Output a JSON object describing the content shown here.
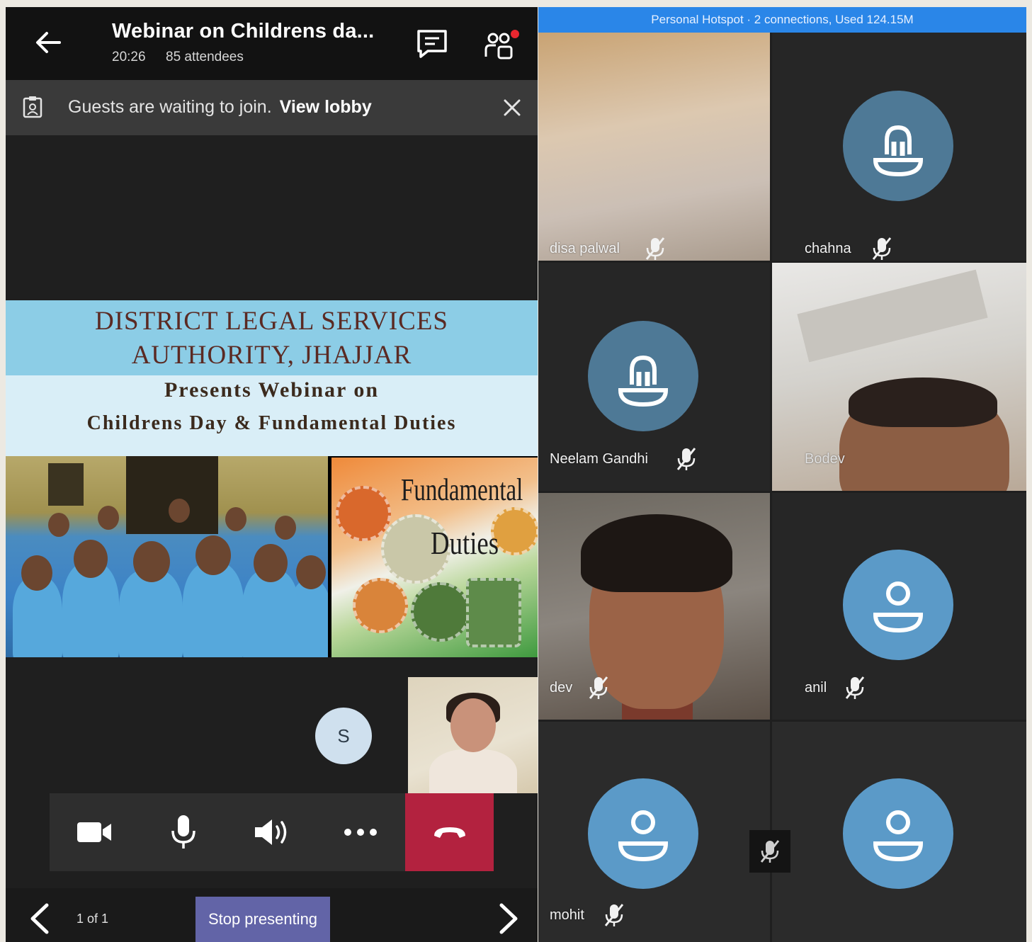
{
  "meeting": {
    "title": "Webinar on Childrens da...",
    "time": "20:26",
    "attendees": "85 attendees"
  },
  "lobby": {
    "message": "Guests are waiting to join.",
    "link": "View lobby"
  },
  "slide": {
    "title_line1": "DISTRICT LEGAL SERVICES",
    "title_line2": "AUTHORITY, JHAJJAR",
    "subtitle_line1": "Presents Webinar on",
    "subtitle_line2": "Childrens Day & Fundamental Duties",
    "image_text1": "Fundamental",
    "image_text2": "Duties"
  },
  "stage": {
    "avatar_initial": "S"
  },
  "controls": {
    "camera": "video-camera-icon",
    "mic": "microphone-icon",
    "speaker": "speaker-icon",
    "more": "more-options-icon",
    "hangup": "hang-up-icon"
  },
  "bottom": {
    "page_count": "1 of 1",
    "stop_presenting": "Stop presenting"
  },
  "status_bar": {
    "hotspot": "Personal Hotspot · 2 connections, Used 124.15M"
  },
  "participants": [
    {
      "name": "disa palwal"
    },
    {
      "name": "chahna"
    },
    {
      "name": "Neelam Gandhi"
    },
    {
      "name": "Bodev"
    },
    {
      "name": "dev"
    },
    {
      "name": "anil"
    },
    {
      "name": "mohit"
    }
  ],
  "colors": {
    "teams_purple": "#6264a7",
    "hangup_red": "#b3223f",
    "hotspot_blue": "#2a86e8",
    "avatar_blue": "#5b9ac8"
  }
}
